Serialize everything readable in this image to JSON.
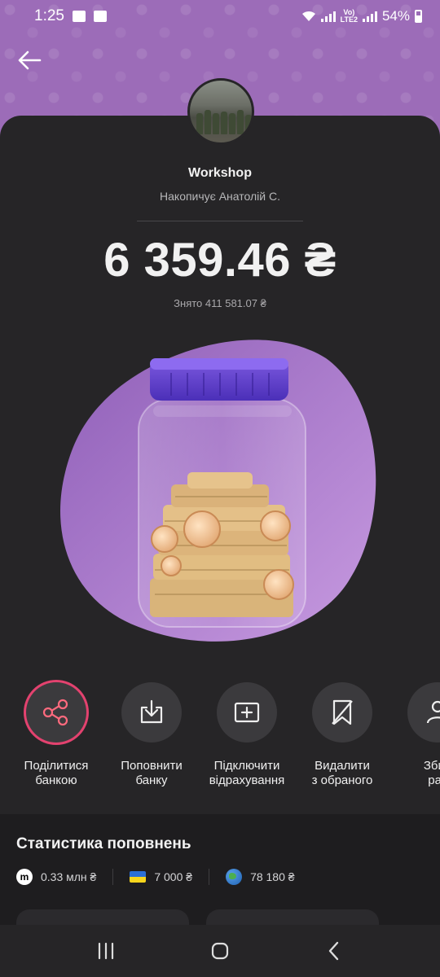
{
  "status_bar": {
    "time": "1:25",
    "battery": "54%",
    "network": "LTE2"
  },
  "jar": {
    "name": "Workshop",
    "owner": "Накопичує Анатолій С.",
    "balance": "6 359.46 ₴",
    "withdrawn": "Знято 411 581.07 ₴"
  },
  "actions": [
    {
      "label": "Поділитися\nбанкою",
      "icon": "share-icon"
    },
    {
      "label": "Поповнити\nбанку",
      "icon": "download-tray-icon"
    },
    {
      "label": "Підключити\nвідрахування",
      "icon": "add-box-icon"
    },
    {
      "label": "Видалити\nз обраного",
      "icon": "bookmark-remove-icon"
    },
    {
      "label": "Збир\nраз",
      "icon": "user-icon"
    }
  ],
  "stats": {
    "title": "Статистика поповнень",
    "items": [
      {
        "value": "0.33 млн ₴",
        "icon": "monobank-icon"
      },
      {
        "value": "7 000 ₴",
        "icon": "ukraine-flag-icon"
      },
      {
        "value": "78 180 ₴",
        "icon": "globe-icon"
      }
    ]
  },
  "colors": {
    "header_purple": "#9c6cb8",
    "card_dark": "#262527",
    "share_ring": "#e3426f",
    "blob_purple": "#a77cc9"
  }
}
